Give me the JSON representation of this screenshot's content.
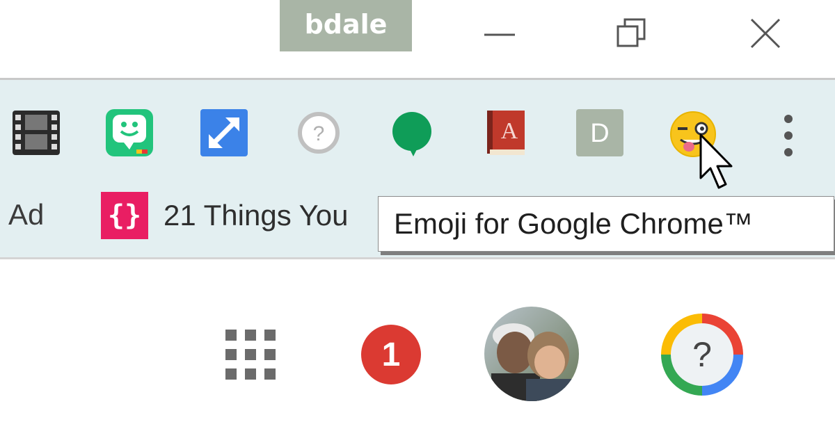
{
  "window": {
    "profile_name": "bdale",
    "controls": [
      "minimize-icon",
      "restore-icon",
      "close-icon"
    ]
  },
  "toolbar": {
    "extensions": [
      {
        "name": "film-extension-icon"
      },
      {
        "name": "bitmoji-extension-icon"
      },
      {
        "name": "expand-extension-icon"
      },
      {
        "name": "help-extension-icon"
      },
      {
        "name": "hangouts-extension-icon"
      },
      {
        "name": "dictionary-extension-icon"
      },
      {
        "name": "d-extension-icon",
        "letter": "D"
      },
      {
        "name": "emoji-extension-icon"
      }
    ],
    "menu_icon": "more-vert-icon"
  },
  "bookmarks": {
    "cut_label": "Ad",
    "items": [
      {
        "icon_text": "{}",
        "label": "21 Things You"
      }
    ]
  },
  "tooltip": {
    "text": "Emoji for Google Chrome™"
  },
  "google_bar": {
    "apps_icon": "apps-grid-icon",
    "notification_count": "1",
    "avatar": "account-avatar",
    "help_symbol": "?"
  },
  "colors": {
    "profile_chip": "#a9b5a6",
    "toolbar_bg": "#e3eff1",
    "bookmark_icon": "#e91e63",
    "notification": "#db3a32",
    "hangouts": "#0f9d58",
    "expand": "#3b82e8"
  }
}
